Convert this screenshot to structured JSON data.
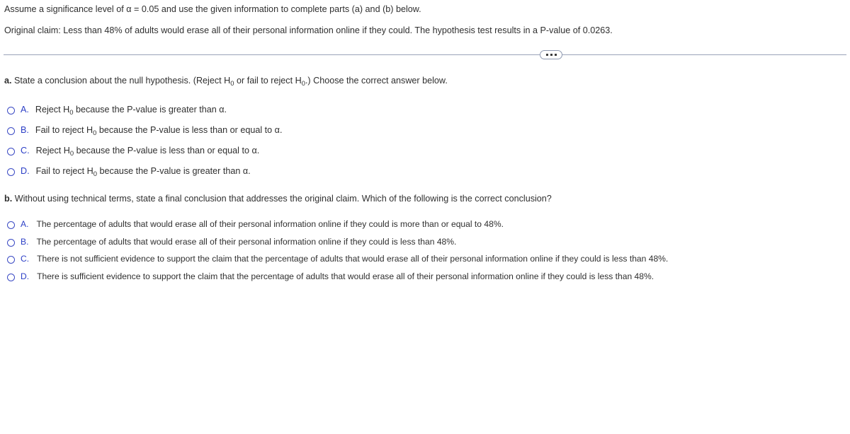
{
  "intro": {
    "line1": "Assume a significance level of α = 0.05 and use the given information to complete parts (a) and (b) below.",
    "line2": "Original claim: Less than 48% of adults would erase all of their personal information online if they could. The hypothesis test results in a P-value of 0.0263."
  },
  "divider": {
    "expand_icon": "ellipsis-icon",
    "dots": "•••"
  },
  "part_a": {
    "label": "a.",
    "prompt_1": "State a conclusion about the null hypothesis. (Reject H",
    "prompt_sub_1": "0",
    "prompt_2": " or fail to reject H",
    "prompt_sub_2": "0",
    "prompt_3": ".) Choose the correct answer below.",
    "options": [
      {
        "letter": "A.",
        "pre": "Reject H",
        "sub": "0",
        "post": " because the P-value is greater than α."
      },
      {
        "letter": "B.",
        "pre": "Fail to reject H",
        "sub": "0",
        "post": " because the P-value is less than or equal to α."
      },
      {
        "letter": "C.",
        "pre": "Reject H",
        "sub": "0",
        "post": " because the P-value is less than or equal to α."
      },
      {
        "letter": "D.",
        "pre": "Fail to reject H",
        "sub": "0",
        "post": " because the P-value is greater than α."
      }
    ]
  },
  "part_b": {
    "label": "b.",
    "prompt": "Without using technical terms, state a final conclusion that addresses the original claim. Which of the following is the correct conclusion?",
    "options": [
      {
        "letter": "A.",
        "text": "The percentage of adults that would erase all of their personal information online if they could is more than or equal to 48%."
      },
      {
        "letter": "B.",
        "text": "The percentage of adults that would erase all of their personal information online if they could is less than 48%."
      },
      {
        "letter": "C.",
        "text": "There is not sufficient evidence to support the claim that the percentage of adults that would erase all of their personal information online if they could is less than 48%."
      },
      {
        "letter": "D.",
        "text": "There is sufficient evidence to support the claim that the percentage of adults that would erase all of their personal information online if they could is less than 48%."
      }
    ]
  },
  "colors": {
    "text": "#2f2f2f",
    "accent_blue": "#2b3ec6",
    "divider": "#9aa3b8",
    "background": "#ffffff"
  }
}
